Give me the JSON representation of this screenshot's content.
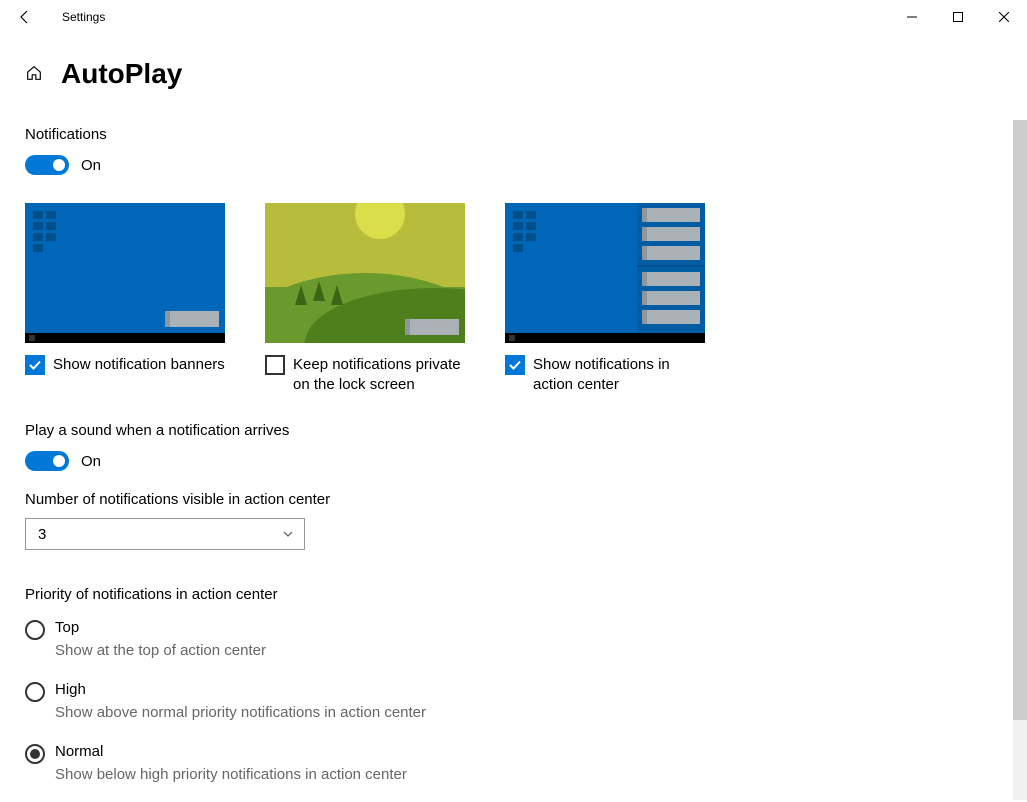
{
  "window": {
    "title": "Settings"
  },
  "page": {
    "title": "AutoPlay"
  },
  "notifications": {
    "label": "Notifications",
    "toggle_state": "On"
  },
  "previews": {
    "banners": {
      "label": "Show notification banners",
      "checked": true
    },
    "lock": {
      "label": "Keep notifications private on the lock screen",
      "checked": false
    },
    "action_center": {
      "label": "Show notifications in action center",
      "checked": true
    }
  },
  "sound": {
    "label": "Play a sound when a notification arrives",
    "toggle_state": "On"
  },
  "visible_count": {
    "label": "Number of notifications visible in action center",
    "value": "3"
  },
  "priority": {
    "label": "Priority of notifications in action center",
    "options": {
      "top": {
        "label": "Top",
        "desc": "Show at the top of action center",
        "selected": false
      },
      "high": {
        "label": "High",
        "desc": "Show above normal priority notifications in action center",
        "selected": false
      },
      "normal": {
        "label": "Normal",
        "desc": "Show below high priority notifications in action center",
        "selected": true
      }
    }
  }
}
